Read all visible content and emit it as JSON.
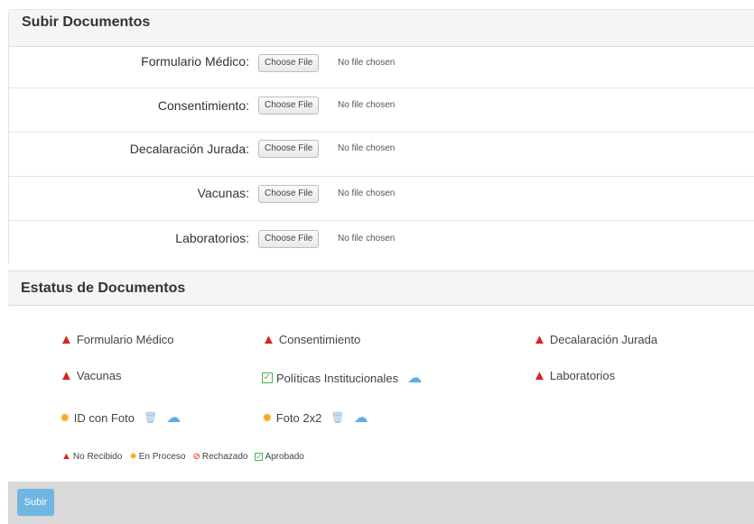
{
  "upload": {
    "title": "Subir Documentos",
    "rows": [
      {
        "label": "Formulario Médico:",
        "button": "Choose File",
        "status": "No file chosen"
      },
      {
        "label": "Consentimiento:",
        "button": "Choose File",
        "status": "No file chosen"
      },
      {
        "label": "Decalaración Jurada:",
        "button": "Choose File",
        "status": "No file chosen"
      },
      {
        "label": "Vacunas:",
        "button": "Choose File",
        "status": "No file chosen"
      },
      {
        "label": "Laboratorios:",
        "button": "Choose File",
        "status": "No file chosen"
      }
    ]
  },
  "status": {
    "title": "Estatus de Documentos",
    "items": [
      {
        "label": "Formulario Médico",
        "state": "warning-icon"
      },
      {
        "label": "Consentimiento",
        "state": "warning-icon"
      },
      {
        "label": "Decalaración Jurada",
        "state": "warning-icon"
      },
      {
        "label": "Vacunas",
        "state": "warning-icon"
      },
      {
        "label": "Políticas Institucionales",
        "state": "check-icon"
      },
      {
        "label": "Laboratorios",
        "state": "warning-icon"
      },
      {
        "label": "ID con Foto",
        "state": "cog-icon"
      },
      {
        "label": "Foto 2x2",
        "state": "cog-icon"
      }
    ],
    "legend": [
      {
        "label": "No Recibido",
        "icon": "warning-icon",
        "color": "#d9241f"
      },
      {
        "label": "En Proceso",
        "icon": "cog-icon",
        "color": "#f0ad1e"
      },
      {
        "label": "Rechazado",
        "icon": "ban-icon",
        "color": "#d9241f"
      },
      {
        "label": "Aprobado",
        "icon": "check-icon",
        "color": "#4caf50"
      }
    ]
  },
  "footer": {
    "submit_label": "Subir"
  },
  "colors": {
    "warning": "#d9241f",
    "approved": "#4caf50",
    "processing": "#f0ad1e",
    "primary": "#6fb6e3"
  }
}
